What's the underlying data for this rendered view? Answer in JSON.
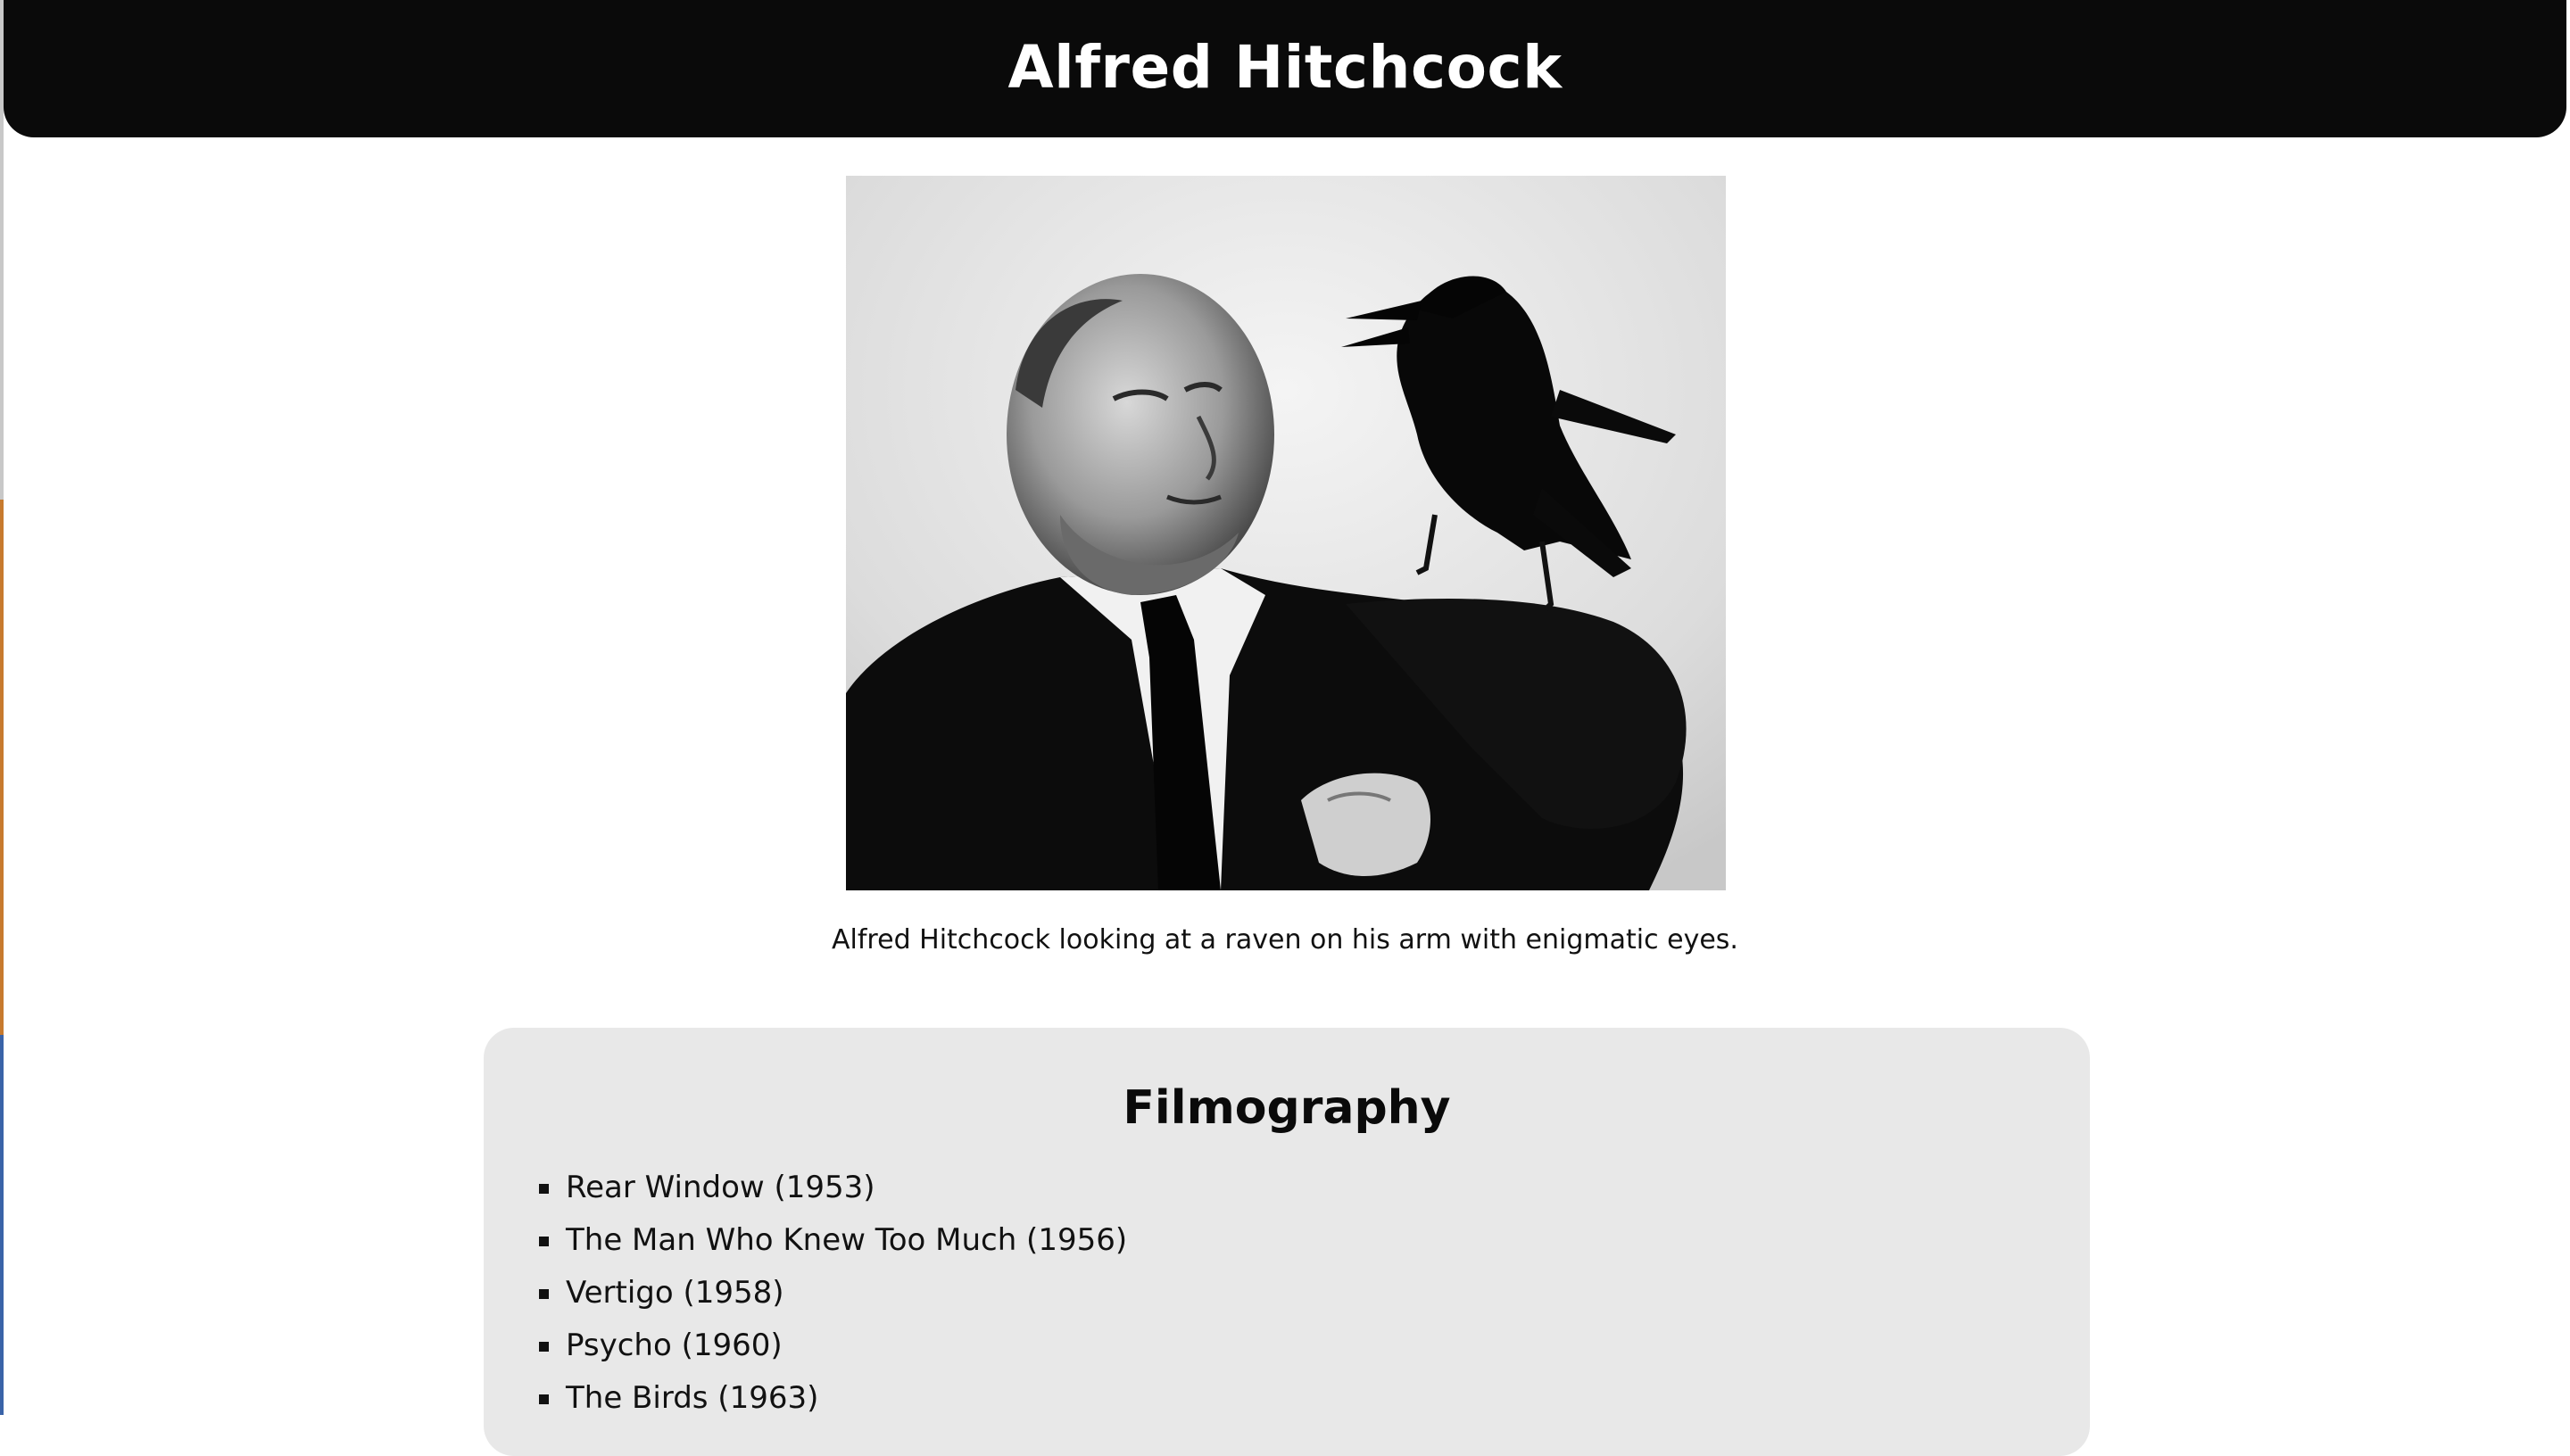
{
  "header": {
    "title": "Alfred Hitchcock"
  },
  "photo": {
    "alt": "Alfred Hitchcock looking at a raven on his arm with enigmatic eyes."
  },
  "caption": "Alfred Hitchcock looking at a raven on his arm with enigmatic eyes.",
  "filmography": {
    "title": "Filmography",
    "films": [
      "Rear Window (1953)",
      "The Man Who Knew Too Much (1956)",
      "Vertigo (1958)",
      "Psycho (1960)",
      "The Birds (1963)"
    ]
  },
  "colors": {
    "header_bg": "#0a0a0a",
    "header_text": "#ffffff",
    "panel_bg": "#e8e8e8",
    "page_bg": "#ffffff"
  }
}
